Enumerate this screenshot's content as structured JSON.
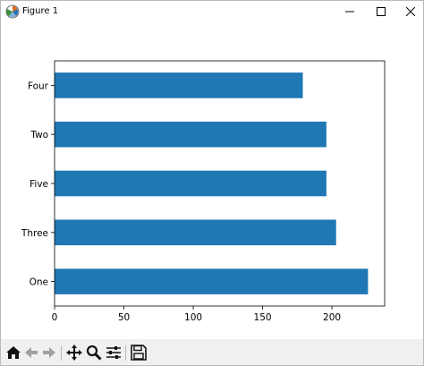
{
  "window": {
    "title": "Figure 1",
    "icons": {
      "app": "matplotlib-icon",
      "minimize": "minimize-icon",
      "maximize": "maximize-icon",
      "close": "close-icon"
    }
  },
  "toolbar": {
    "buttons": [
      {
        "icon": "home-icon"
      },
      {
        "icon": "back-arrow-icon"
      },
      {
        "icon": "forward-arrow-icon"
      },
      {
        "icon": "pan-icon"
      },
      {
        "icon": "zoom-icon"
      },
      {
        "icon": "configure-subplots-icon"
      },
      {
        "icon": "save-icon"
      }
    ]
  },
  "colors": {
    "bar": "#1f77b4",
    "axes": "#000000",
    "toolbar_bg": "#f0f0f0"
  },
  "chart_data": {
    "type": "bar",
    "orientation": "horizontal",
    "categories": [
      "One",
      "Three",
      "Five",
      "Two",
      "Four"
    ],
    "values": [
      226,
      203,
      196,
      196,
      179
    ],
    "xlim": [
      0,
      238
    ],
    "xticks": [
      0,
      50,
      100,
      150,
      200
    ],
    "title": "",
    "xlabel": "",
    "ylabel": "",
    "grid": false,
    "legend": "none"
  }
}
